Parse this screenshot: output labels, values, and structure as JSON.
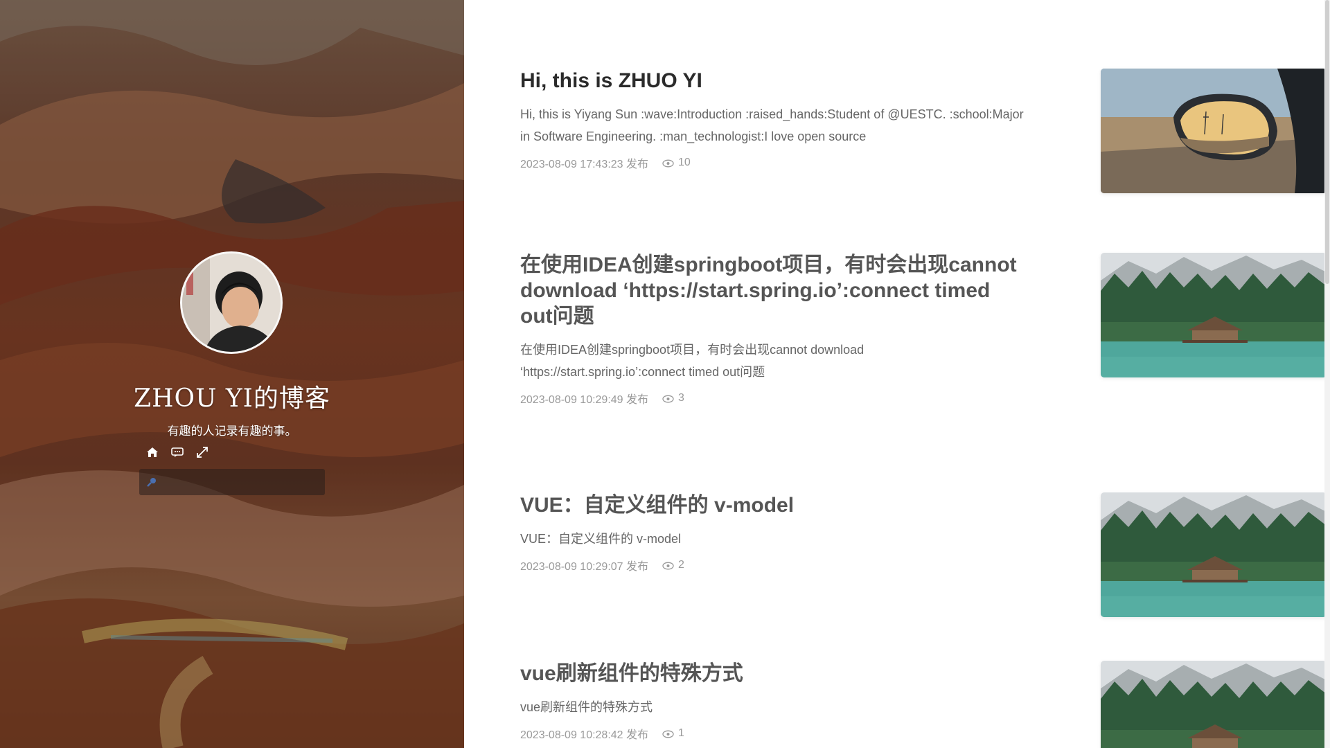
{
  "blog": {
    "title": "ZHOU YI的博客",
    "subtitle": "有趣的人记录有趣的事。"
  },
  "hero_icons": [
    "home-icon",
    "comment-icon",
    "fullscreen-icon"
  ],
  "search": {
    "placeholder": "",
    "value": ""
  },
  "posts": [
    {
      "title": "Hi, this is ZHUO YI",
      "summary": "Hi, this is Yiyang Sun :wave:Introduction :raised_hands:Student of @UESTC. :school:Major in Software Engineering. :man_technologist:I love open source",
      "date": "2023-08-09 17:43:23 发布",
      "views": "10",
      "image": "car-mirror-photo"
    },
    {
      "title": "在使用IDEA创建springboot项目，有时会出现cannot download ‘https://start.spring.io’:connect timed out问题",
      "summary": "在使用IDEA创建springboot项目，有时会出现cannot download ‘https://start.spring.io’:connect timed out问题",
      "date": "2023-08-09 10:29:49 发布",
      "views": "3",
      "image": "lake-cabin-photo"
    },
    {
      "title": "VUE：自定义组件的 v-model",
      "summary": "VUE：自定义组件的 v-model",
      "date": "2023-08-09 10:29:07 发布",
      "views": "2",
      "image": "lake-cabin-photo"
    },
    {
      "title": "vue刷新组件的特殊方式",
      "summary": "vue刷新组件的特殊方式",
      "date": "2023-08-09 10:28:42 发布",
      "views": "1",
      "image": "lake-cabin-photo"
    }
  ],
  "colors": {
    "accent_text": "#2b2b2b",
    "muted_text": "#9a9a9a",
    "panel": "#6e3a26"
  }
}
